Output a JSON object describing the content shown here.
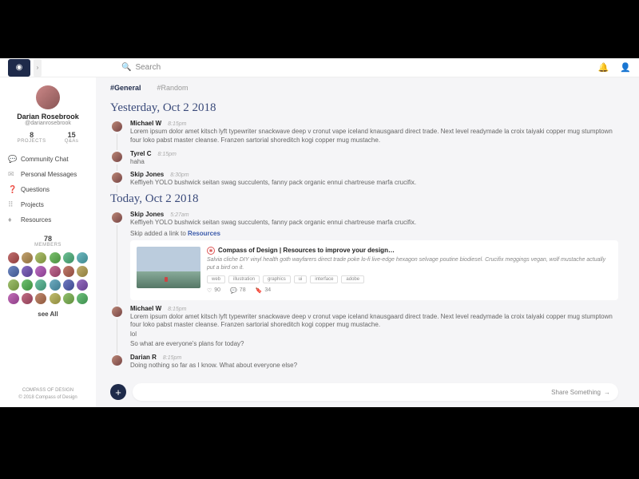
{
  "search_placeholder": "Search",
  "user": {
    "name": "Darian Rosebrook",
    "handle": "@darianrosebrook"
  },
  "stats": [
    {
      "n": "8",
      "l": "PROJECTS"
    },
    {
      "n": "15",
      "l": "Q&As"
    }
  ],
  "nav": [
    {
      "icon": "💬",
      "label": "Community Chat"
    },
    {
      "icon": "✉",
      "label": "Personal Messages"
    },
    {
      "icon": "❓",
      "label": "Questions"
    },
    {
      "icon": "⠿",
      "label": "Projects"
    },
    {
      "icon": "♦",
      "label": "Resources"
    }
  ],
  "members": {
    "count": "78",
    "label": "MEMBERS",
    "see_all": "see All"
  },
  "brand": {
    "line1": "COMPASS OF DESIGN",
    "line2": "© 2018 Compass of Design"
  },
  "tabs": [
    {
      "label": "#General",
      "active": true
    },
    {
      "label": "#Random",
      "active": false
    }
  ],
  "dates": {
    "d1": "Yesterday, Oct 2 2018",
    "d2": "Today, Oct 2 2018"
  },
  "messages": {
    "m1": {
      "name": "Michael W",
      "time": "8:15pm",
      "text": "Lorem ipsum dolor amet kitsch lyft typewriter snackwave deep v cronut vape iceland knausgaard direct trade. Next level readymade la croix taiyaki copper mug stumptown four loko pabst master cleanse. Franzen sartorial shoreditch kogi copper mug mustache."
    },
    "m2": {
      "name": "Tyrel C",
      "time": "8:15pm",
      "text": "haha"
    },
    "m3": {
      "name": "Skip Jones",
      "time": "8:30pm",
      "text": "Keffiyeh YOLO bushwick seitan swag succulents, fanny pack organic ennui chartreuse marfa crucifix."
    },
    "m4": {
      "name": "Skip Jones",
      "time": "5:27am",
      "text": "Keffiyeh YOLO bushwick seitan swag succulents, fanny pack organic ennui chartreuse marfa crucifix."
    },
    "m5": {
      "name": "Michael W",
      "time": "8:15pm",
      "text": "Lorem ipsum dolor amet kitsch lyft typewriter snackwave deep v cronut vape iceland knausgaard direct trade. Next level readymade la croix taiyaki copper mug stumptown four loko pabst master cleanse. Franzen sartorial shoreditch kogi copper mug mustache.",
      "extra1": "lol",
      "extra2": "So what are everyone's plans for today?"
    },
    "m6": {
      "name": "Darian R",
      "time": "8:15pm",
      "text": "Doing nothing so far as I know. What about everyone else?"
    }
  },
  "link_note": {
    "prefix": "Skip added a link to ",
    "target": "Resources"
  },
  "card": {
    "title": "Compass of Design | Resources to improve your design…",
    "desc": "Salvia cliche DIY vinyl health goth wayfarers direct trade poke lo-fi live-edge hexagon selvage poutine biodiesel. Crucifix meggings vegan, wolf mustache actually put a bird on it.",
    "tags": [
      "web",
      "illustration",
      "graphics",
      "ui",
      "interface",
      "adobe"
    ],
    "stats": [
      {
        "icon": "♡",
        "n": "90"
      },
      {
        "icon": "💬",
        "n": "78"
      },
      {
        "icon": "🔖",
        "n": "34"
      }
    ]
  },
  "composer": {
    "placeholder": "Share Something"
  }
}
